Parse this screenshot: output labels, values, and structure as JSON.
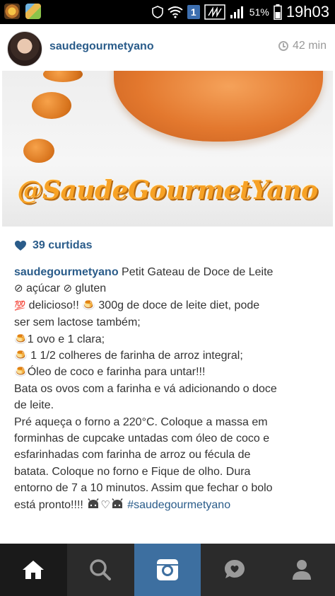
{
  "status_bar": {
    "notification_count": "1",
    "battery_percent": "51%",
    "time": "19h03"
  },
  "post": {
    "username": "saudegourmetyano",
    "time_ago": "42 min",
    "image_watermark": "@SaudeGourmetYano",
    "likes": "39 curtidas"
  },
  "caption": {
    "username": "saudegourmetyano",
    "lines": {
      "l1": "Petit Gateau de Doce de Leite",
      "l2a": "açúcar",
      "l2b": "gluten",
      "l3a": "delicioso!!",
      "l3b": "300g de doce de leite diet, pode",
      "l4": "ser sem lactose também;",
      "l5": "1 ovo e 1 clara;",
      "l6": "1 1/2 colheres de farinha de arroz integral;",
      "l7": "Óleo de coco e farinha para untar!!!",
      "l8": "Bata os ovos com a farinha e vá adicionando o doce",
      "l9": "de leite.",
      "l10": "Pré aqueça o forno a 220°C. Coloque a massa em",
      "l11": "forminhas de cupcake untadas com óleo de coco e",
      "l12": "esfarinhadas com farinha de arroz ou fécula de",
      "l13": "batata. Coloque no forno e Fique de olho. Dura",
      "l14": "entorno de 7 a 10 minutos. Assim que fechar o bolo",
      "l15": "está pronto!!!!"
    },
    "hashtag": "#saudegourmetyano",
    "emoji": {
      "prohibited": "⊘",
      "hundred": "💯",
      "dessert": "🍮",
      "white_heart": "♡"
    }
  },
  "nav": {
    "items": [
      "home",
      "search",
      "camera",
      "activity",
      "profile"
    ],
    "active": "home"
  },
  "colors": {
    "link_blue": "#2a5c8a",
    "nav_bg": "#2b2b2b",
    "camera_tab": "#3d6fa0",
    "watermark_orange": "#f7a226"
  }
}
